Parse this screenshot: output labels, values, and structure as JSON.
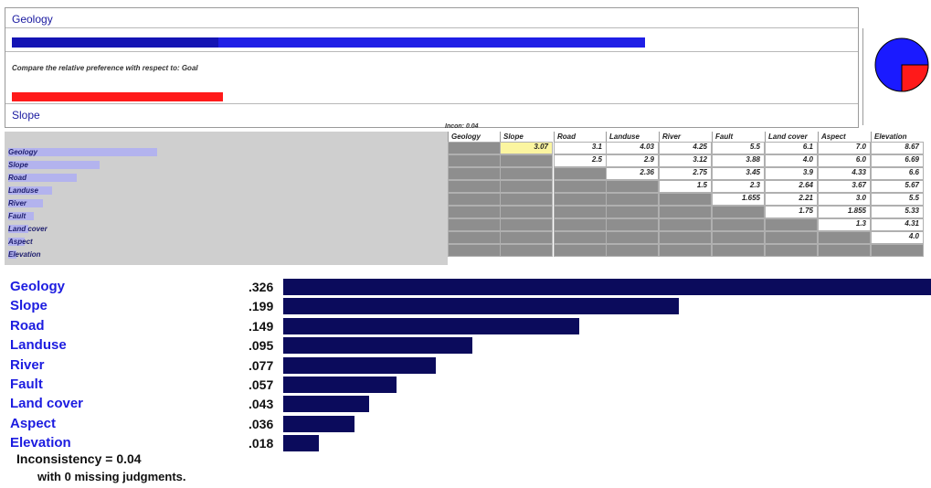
{
  "goal_panel": {
    "element_a": "Geology",
    "compare_text": "Compare the relative preference with respect to: Goal",
    "element_b": "Slope",
    "colors": {
      "bar_a": "#1f1fe6",
      "bar_b": "#ff1a1a",
      "pie_main": "#1a1aff",
      "pie_slice": "#ff1a1a"
    }
  },
  "matrix": {
    "rows": [
      "Geology",
      "Slope",
      "Road",
      "Landuse",
      "River",
      "Fault",
      "Land cover",
      "Aspect",
      "Elevation"
    ],
    "columns": [
      "Geology",
      "Slope",
      "Road",
      "Landuse",
      "River",
      "Fault",
      "Land cover",
      "Aspect",
      "Elevation"
    ],
    "values": [
      [
        "",
        "3.07",
        "3.1",
        "4.03",
        "4.25",
        "5.5",
        "6.1",
        "7.0",
        "8.67"
      ],
      [
        "",
        "",
        "2.5",
        "2.9",
        "3.12",
        "3.88",
        "4.0",
        "6.0",
        "6.69"
      ],
      [
        "",
        "",
        "",
        "2.36",
        "2.75",
        "3.45",
        "3.9",
        "4.33",
        "6.6"
      ],
      [
        "",
        "",
        "",
        "",
        "1.5",
        "2.3",
        "2.64",
        "3.67",
        "5.67"
      ],
      [
        "",
        "",
        "",
        "",
        "",
        "1.655",
        "2.21",
        "3.0",
        "5.5"
      ],
      [
        "",
        "",
        "",
        "",
        "",
        "",
        "1.75",
        "1.855",
        "5.33"
      ],
      [
        "",
        "",
        "",
        "",
        "",
        "",
        "",
        "1.3",
        "4.31"
      ],
      [
        "",
        "",
        "",
        "",
        "",
        "",
        "",
        "",
        "4.0"
      ],
      [
        "",
        "",
        "",
        "",
        "",
        "",
        "",
        "",
        ""
      ]
    ],
    "incon_label": "Incon: 0.04"
  },
  "priorities": [
    {
      "name": "Geology",
      "value": ".326"
    },
    {
      "name": "Slope",
      "value": ".199"
    },
    {
      "name": "Road",
      "value": ".149"
    },
    {
      "name": "Landuse",
      "value": ".095"
    },
    {
      "name": "River",
      "value": ".077"
    },
    {
      "name": "Fault",
      "value": ".057"
    },
    {
      "name": "Land cover",
      "value": ".043"
    },
    {
      "name": "Aspect",
      "value": ".036"
    },
    {
      "name": "Elevation",
      "value": ".018"
    }
  ],
  "priority_bar_color": "#0b0b5c",
  "inconsistency_text": "Inconsistency = 0.04",
  "missing_text": "with 0  missing judgments."
}
